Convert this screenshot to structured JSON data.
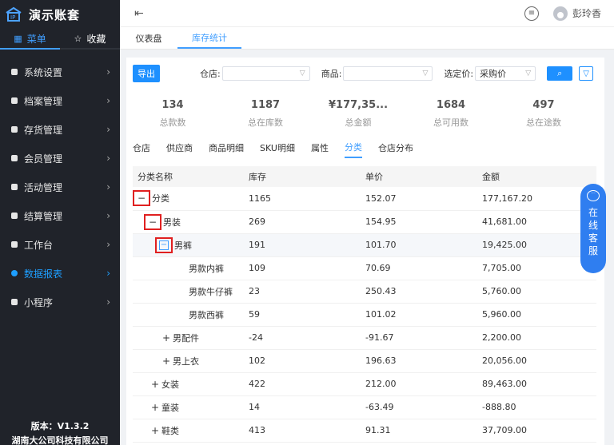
{
  "brand": {
    "title": "演示账套"
  },
  "sidebar": {
    "tabs": [
      {
        "label": "菜单",
        "icon": "grid-icon"
      },
      {
        "label": "收藏",
        "icon": "star-icon"
      }
    ],
    "items": [
      {
        "label": "系统设置"
      },
      {
        "label": "档案管理"
      },
      {
        "label": "存货管理"
      },
      {
        "label": "会员管理"
      },
      {
        "label": "活动管理"
      },
      {
        "label": "结算管理"
      },
      {
        "label": "工作台"
      },
      {
        "label": "数据报表"
      },
      {
        "label": "小程序"
      }
    ],
    "version": "版本：V1.3.2",
    "company": "湖南大公司科技有限公司"
  },
  "topbar": {
    "username": "彭玲香"
  },
  "pagetabs": [
    {
      "label": "仪表盘"
    },
    {
      "label": "库存统计"
    }
  ],
  "filters": {
    "export": "导出",
    "store_label": "仓店:",
    "product_label": "商品:",
    "price_label": "选定价:",
    "price_value": "采购价"
  },
  "stats": [
    {
      "value": "134",
      "label": "总款数"
    },
    {
      "value": "1187",
      "label": "总在库数"
    },
    {
      "value": "¥177,35...",
      "label": "总金额"
    },
    {
      "value": "1684",
      "label": "总可用数"
    },
    {
      "value": "497",
      "label": "总在途数"
    }
  ],
  "subtabs": [
    {
      "label": "仓店"
    },
    {
      "label": "供应商"
    },
    {
      "label": "商品明细"
    },
    {
      "label": "SKU明细"
    },
    {
      "label": "属性"
    },
    {
      "label": "分类"
    },
    {
      "label": "仓店分布"
    }
  ],
  "table": {
    "headers": [
      "分类名称",
      "库存",
      "单价",
      "金额"
    ],
    "rows": [
      {
        "name": "分类",
        "stock": "1165",
        "price": "152.07",
        "amount": "177,167.20"
      },
      {
        "name": "男装",
        "stock": "269",
        "price": "154.95",
        "amount": "41,681.00"
      },
      {
        "name": "男裤",
        "stock": "191",
        "price": "101.70",
        "amount": "19,425.00"
      },
      {
        "name": "男款内裤",
        "stock": "109",
        "price": "70.69",
        "amount": "7,705.00"
      },
      {
        "name": "男款牛仔裤",
        "stock": "23",
        "price": "250.43",
        "amount": "5,760.00"
      },
      {
        "name": "男款西裤",
        "stock": "59",
        "price": "101.02",
        "amount": "5,960.00"
      },
      {
        "name": "男配件",
        "stock": "-24",
        "price": "-91.67",
        "amount": "2,200.00"
      },
      {
        "name": "男上衣",
        "stock": "102",
        "price": "196.63",
        "amount": "20,056.00"
      },
      {
        "name": "女装",
        "stock": "422",
        "price": "212.00",
        "amount": "89,463.00"
      },
      {
        "name": "童装",
        "stock": "14",
        "price": "-63.49",
        "amount": "-888.80"
      },
      {
        "name": "鞋类",
        "stock": "413",
        "price": "91.31",
        "amount": "37,709.00"
      }
    ]
  },
  "chat": {
    "text": [
      "在",
      "线",
      "客",
      "服"
    ]
  }
}
